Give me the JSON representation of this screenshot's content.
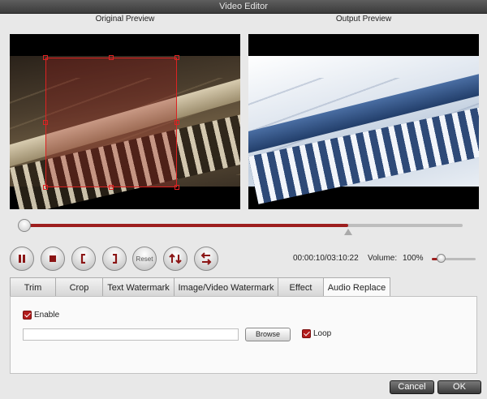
{
  "window": {
    "title": "Video Editor"
  },
  "previews": {
    "original_label": "Original Preview",
    "output_label": "Output Preview"
  },
  "timeline": {
    "progress": 0.74,
    "marker_icon": "trim-end-marker"
  },
  "controls": {
    "pause_icon": "pause-icon",
    "stop_icon": "stop-icon",
    "mark_in_icon": "mark-in-icon",
    "mark_out_icon": "mark-out-icon",
    "reset_label": "Reset",
    "flip_vertical_icon": "flip-vertical-icon",
    "flip_horizontal_icon": "flip-horizontal-icon"
  },
  "playback": {
    "time": "00:00:10/03:10:22",
    "volume_label": "Volume:",
    "volume_value": "100%",
    "volume_level": 0.15
  },
  "tabs": [
    {
      "label": "Trim"
    },
    {
      "label": "Crop"
    },
    {
      "label": "Text Watermark"
    },
    {
      "label": "Image/Video Watermark"
    },
    {
      "label": "Effect"
    },
    {
      "label": "Audio Replace",
      "active": true
    }
  ],
  "audio_replace": {
    "enable_label": "Enable",
    "enable_checked": true,
    "file_path": "",
    "browse_label": "Browse",
    "loop_label": "Loop",
    "loop_checked": true
  },
  "footer": {
    "cancel_label": "Cancel",
    "ok_label": "OK"
  },
  "colors": {
    "accent": "#9d1e1e",
    "crop_border": "#dd2222"
  }
}
